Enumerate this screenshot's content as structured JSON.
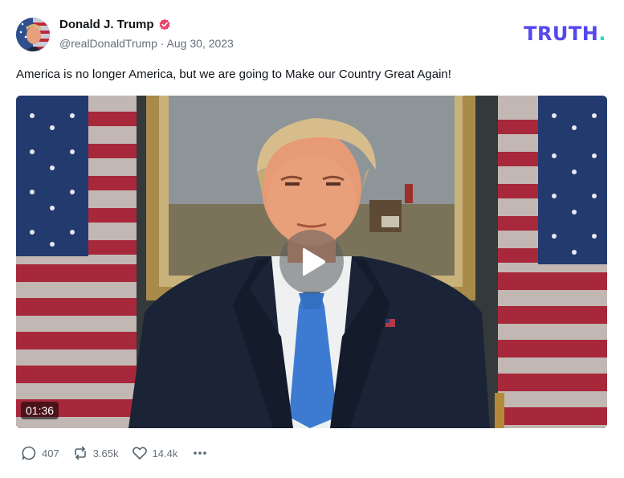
{
  "post": {
    "author_name": "Donald J. Trump",
    "handle": "@realDonaldTrump",
    "separator": "·",
    "date": "Aug 30, 2023",
    "text": "America is no longer America, but we are going to Make our Country Great Again!",
    "verified_icon": "verified-badge-icon",
    "verified_color": "#e6446b"
  },
  "brand": {
    "logo_text": "TRUTH",
    "logo_dot": ".",
    "logo_color": "#5448ee",
    "dot_color": "#17e3c2"
  },
  "video": {
    "duration": "01:36",
    "play_icon": "play-icon"
  },
  "actions": {
    "replies": "407",
    "retruths": "3.65k",
    "likes": "14.4k",
    "reply_icon": "comment-icon",
    "retruth_icon": "retruth-icon",
    "like_icon": "heart-icon",
    "more_icon": "more-dots-icon"
  }
}
